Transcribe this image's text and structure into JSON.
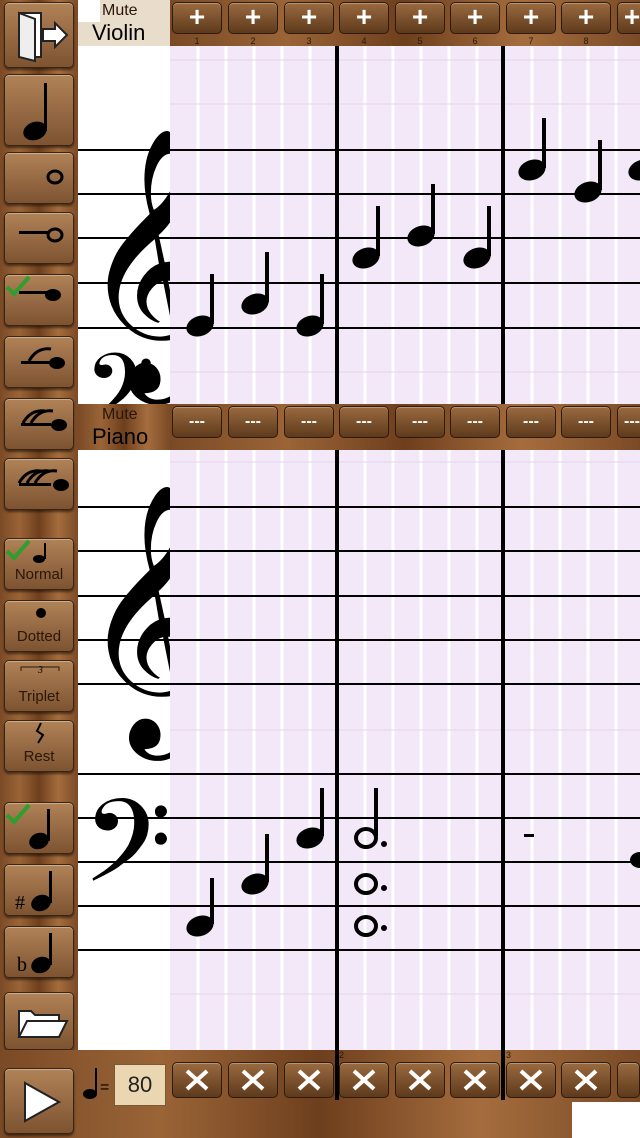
{
  "instruments": [
    {
      "mute_label": "Mute",
      "name": "Violin"
    },
    {
      "mute_label": "Mute",
      "name": "Piano"
    }
  ],
  "measure_numbers": [
    "1",
    "2",
    "3",
    "4",
    "5",
    "6",
    "7",
    "8"
  ],
  "bar_numbers": [
    "2",
    "3"
  ],
  "header_button_violin": "+",
  "header_button_piano": "---",
  "toolbar": {
    "normal_label": "Normal",
    "dotted_label": "Dotted",
    "triplet_label": "Triplet",
    "rest_label": "Rest"
  },
  "tempo": {
    "value": "80"
  },
  "colors": {
    "staff_bg": "#f3e8f7",
    "check": "#2e9e2e"
  },
  "icons": [
    "exit-icon",
    "quarter-note-icon",
    "whole-note-icon",
    "half-note-icon",
    "eighth-note-icon",
    "sixteenth-note-icon",
    "thirty-second-note-icon",
    "natural-icon",
    "sharp-icon",
    "flat-icon",
    "open-folder-icon",
    "play-icon",
    "tools-icon"
  ]
}
